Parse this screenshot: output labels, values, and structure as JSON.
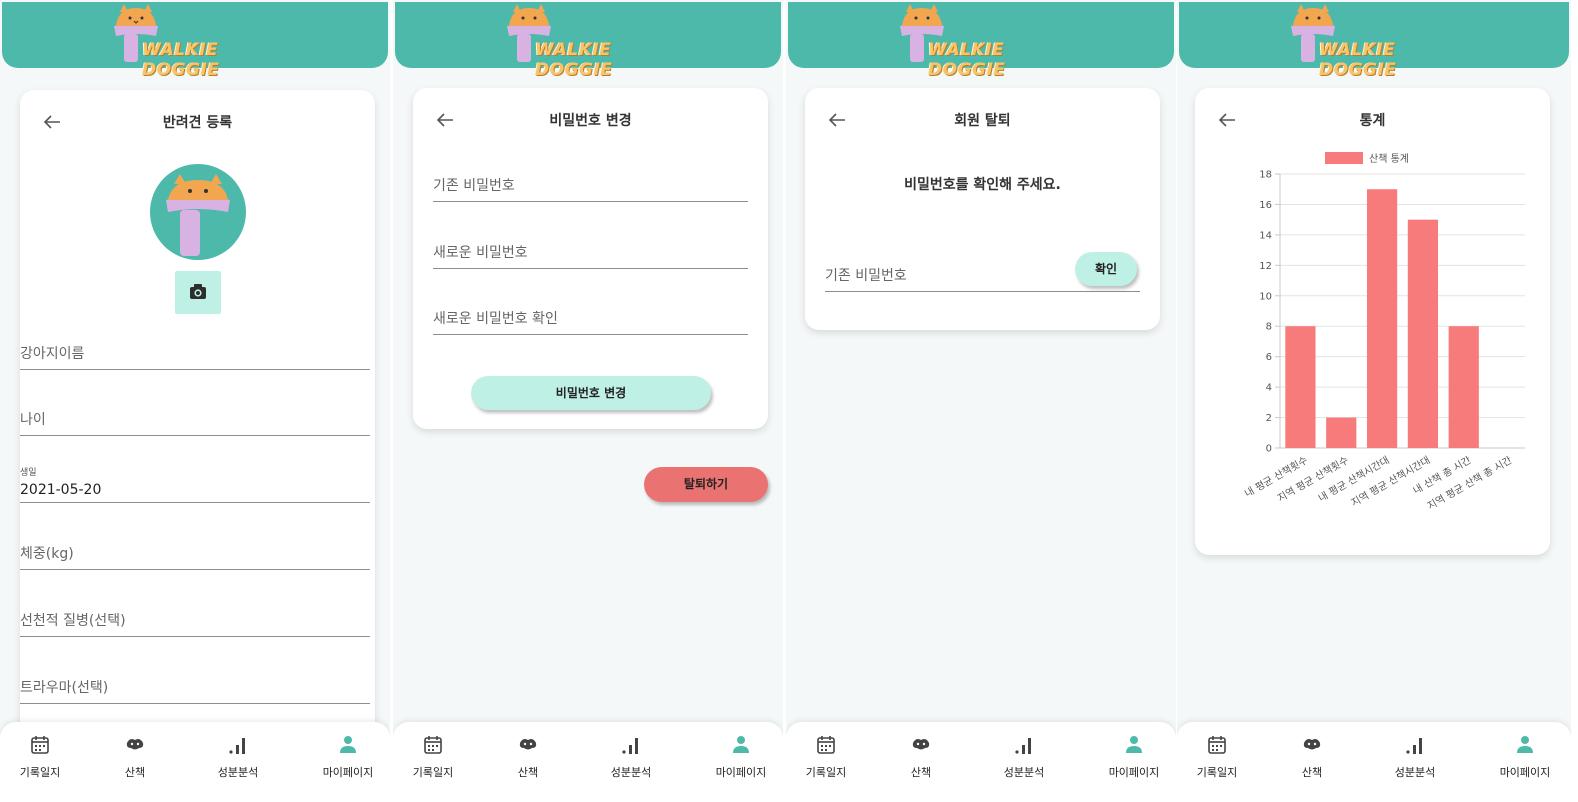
{
  "app": {
    "brand": "WALKIE DOGGIE",
    "accent": "#4db9aa",
    "mint": "#bff0e5",
    "danger": "#ea7372",
    "bar_color": "#f77b7b"
  },
  "nav": {
    "items": [
      {
        "label": "기록일지",
        "icon": "calendar-icon"
      },
      {
        "label": "산책",
        "icon": "paw-icon"
      },
      {
        "label": "성분분석",
        "icon": "signal-bars-icon"
      },
      {
        "label": "마이페이지",
        "icon": "person-icon"
      }
    ],
    "active_index": 3
  },
  "screen1": {
    "title": "반려견 등록",
    "fields": {
      "name": "강아지이름",
      "age": "나이",
      "birth_label": "생일",
      "birth_value": "2021-05-20",
      "weight": "체중(kg)",
      "disease": "선천적 질병(선택)",
      "trauma": "트라우마(선택)"
    }
  },
  "screen2": {
    "title": "비밀번호 변경",
    "fields": {
      "current": "기존 비밀번호",
      "new": "새로운 비밀번호",
      "confirm": "새로운 비밀번호 확인"
    },
    "submit": "비밀번호 변경",
    "withdraw": "탈퇴하기"
  },
  "screen3": {
    "title": "회원 탈퇴",
    "prompt": "비밀번호를 확인해 주세요.",
    "field": "기존 비밀번호",
    "confirm": "확인"
  },
  "screen4": {
    "title": "통계"
  },
  "chart_data": {
    "type": "bar",
    "categories": [
      "내 평균 산책횟수",
      "지역 평균 산책횟수",
      "내 평균 산책시간대",
      "지역 평균 산책시간대",
      "내 산책 총 시간",
      "지역 평균 산책 총 시간"
    ],
    "series": [
      {
        "name": "산책 통계",
        "values": [
          8,
          2,
          17,
          15,
          8,
          0
        ]
      }
    ],
    "yticks": [
      "0",
      "2",
      "4",
      "6",
      "8",
      "10",
      "12",
      "14",
      "16",
      "18"
    ],
    "ylim": [
      0,
      18
    ],
    "grid": true,
    "legend": "top"
  }
}
